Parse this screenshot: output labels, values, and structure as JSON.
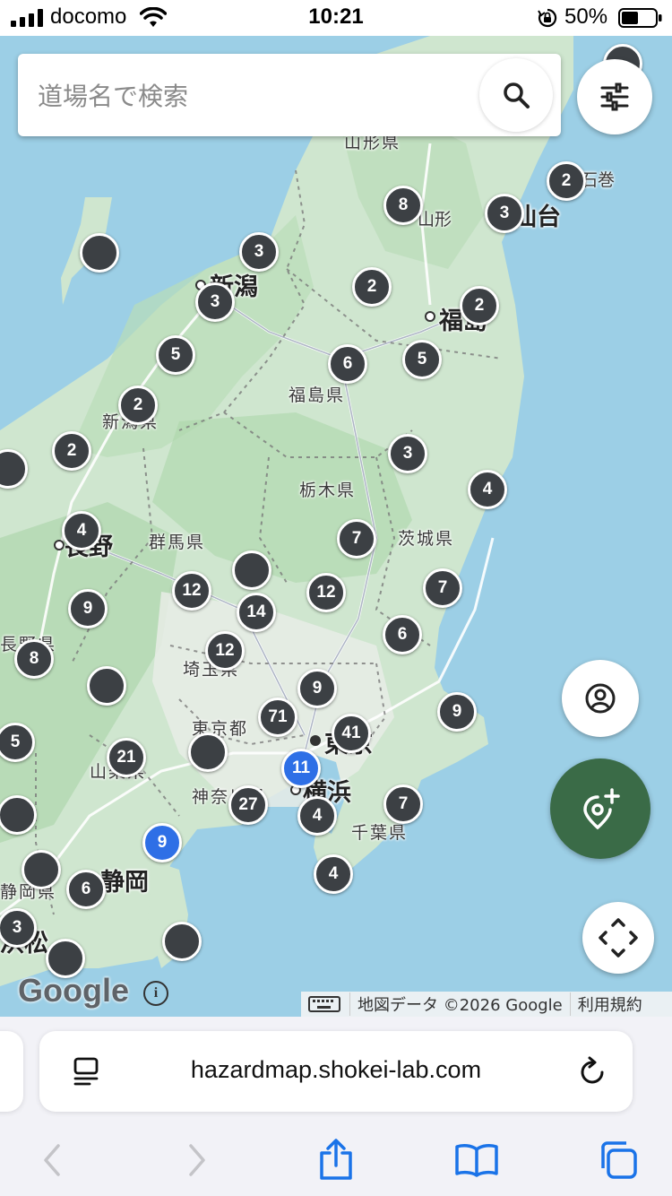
{
  "status_bar": {
    "carrier": "docomo",
    "time": "10:21",
    "battery": "50%"
  },
  "search": {
    "placeholder": "道場名で検索"
  },
  "map": {
    "place_labels": [
      {
        "text": "山形県",
        "class": "pref"
      },
      {
        "text": "石巻",
        "class": "small"
      },
      {
        "text": "山形",
        "class": "small"
      },
      {
        "text": "仙台",
        "class": "city"
      },
      {
        "text": "新潟",
        "class": "city"
      },
      {
        "text": "福島",
        "class": "city"
      },
      {
        "text": "福島県",
        "class": "pref"
      },
      {
        "text": "新潟県",
        "class": "pref"
      },
      {
        "text": "栃木県",
        "class": "pref"
      },
      {
        "text": "群馬県",
        "class": "pref"
      },
      {
        "text": "茨城県",
        "class": "pref"
      },
      {
        "text": "長野",
        "class": "city"
      },
      {
        "text": "長野県",
        "class": "pref"
      },
      {
        "text": "埼玉県",
        "class": "pref"
      },
      {
        "text": "東京都",
        "class": "pref"
      },
      {
        "text": "東京",
        "class": "city"
      },
      {
        "text": "山梨県",
        "class": "pref"
      },
      {
        "text": "神奈川県",
        "class": "pref"
      },
      {
        "text": "横浜",
        "class": "city"
      },
      {
        "text": "千葉県",
        "class": "pref"
      },
      {
        "text": "静岡県",
        "class": "pref"
      },
      {
        "text": "静岡",
        "class": "city"
      },
      {
        "text": "浜松",
        "class": "city"
      }
    ],
    "markers": [
      {
        "count": "",
        "color": "dark"
      },
      {
        "count": "2",
        "color": "dark"
      },
      {
        "count": "8",
        "color": "dark"
      },
      {
        "count": "3",
        "color": "dark"
      },
      {
        "count": "",
        "color": "dark"
      },
      {
        "count": "3",
        "color": "dark"
      },
      {
        "count": "3",
        "color": "dark"
      },
      {
        "count": "2",
        "color": "dark"
      },
      {
        "count": "2",
        "color": "dark"
      },
      {
        "count": "5",
        "color": "dark"
      },
      {
        "count": "6",
        "color": "dark"
      },
      {
        "count": "5",
        "color": "dark"
      },
      {
        "count": "2",
        "color": "dark"
      },
      {
        "count": "2",
        "color": "dark"
      },
      {
        "count": "",
        "color": "dark"
      },
      {
        "count": "3",
        "color": "dark"
      },
      {
        "count": "4",
        "color": "dark"
      },
      {
        "count": "4",
        "color": "dark"
      },
      {
        "count": "7",
        "color": "dark"
      },
      {
        "count": "",
        "color": "dark"
      },
      {
        "count": "12",
        "color": "dark"
      },
      {
        "count": "12",
        "color": "dark"
      },
      {
        "count": "7",
        "color": "dark"
      },
      {
        "count": "9",
        "color": "dark"
      },
      {
        "count": "14",
        "color": "dark"
      },
      {
        "count": "6",
        "color": "dark"
      },
      {
        "count": "12",
        "color": "dark"
      },
      {
        "count": "8",
        "color": "dark"
      },
      {
        "count": "",
        "color": "dark"
      },
      {
        "count": "9",
        "color": "dark"
      },
      {
        "count": "9",
        "color": "dark"
      },
      {
        "count": "71",
        "color": "dark"
      },
      {
        "count": "41",
        "color": "dark"
      },
      {
        "count": "5",
        "color": "dark"
      },
      {
        "count": "21",
        "color": "dark"
      },
      {
        "count": "",
        "color": "dark"
      },
      {
        "count": "11",
        "color": "blue"
      },
      {
        "count": "27",
        "color": "dark"
      },
      {
        "count": "4",
        "color": "dark"
      },
      {
        "count": "7",
        "color": "dark"
      },
      {
        "count": "",
        "color": "dark"
      },
      {
        "count": "9",
        "color": "blue"
      },
      {
        "count": "",
        "color": "dark"
      },
      {
        "count": "6",
        "color": "dark"
      },
      {
        "count": "4",
        "color": "dark"
      },
      {
        "count": "3",
        "color": "dark"
      },
      {
        "count": "",
        "color": "dark"
      },
      {
        "count": "",
        "color": "dark"
      }
    ],
    "logo": "Google",
    "attribution": {
      "data": "地図データ ©2026 Google",
      "terms": "利用規約"
    }
  },
  "buttons": {
    "filter_icon": "sliders-icon",
    "profile_icon": "account-circle-icon",
    "add_location_icon": "add-location-icon",
    "recenter_icon": "expand-arrows-icon"
  },
  "safari": {
    "url": "hazardmap.shokei-lab.com"
  },
  "colors": {
    "sea": "#9ccfe6",
    "land": "#cfe6cf",
    "marker": "#3c4044",
    "marker_selected": "#2e6fe6",
    "fab_green": "#3a6b47",
    "ios_blue": "#1a73e8"
  }
}
